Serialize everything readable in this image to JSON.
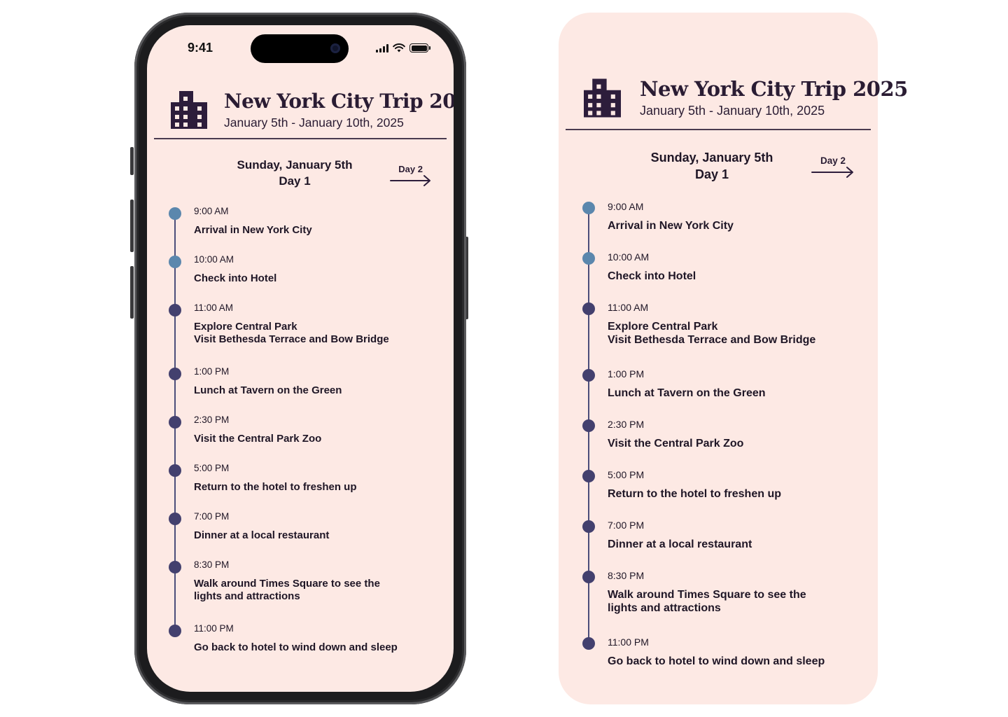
{
  "status_bar": {
    "time": "9:41"
  },
  "trip": {
    "title": "New York City Trip 2025",
    "dates": "January 5th - January 10th, 2025",
    "icon": "building-icon"
  },
  "day": {
    "date": "Sunday, January 5th",
    "label": "Day 1",
    "next_label": "Day 2",
    "next_icon": "arrow-right-icon"
  },
  "colors": {
    "background": "#fde9e4",
    "text": "#2a1c33",
    "dot_completed": "#5b87ad",
    "dot_upcoming": "#43406e",
    "line": "#4c4d7a"
  },
  "events": [
    {
      "time": "9:00 AM",
      "lines": [
        "Arrival in New York City"
      ],
      "status": "completed"
    },
    {
      "time": "10:00 AM",
      "lines": [
        "Check into Hotel"
      ],
      "status": "completed"
    },
    {
      "time": "11:00 AM",
      "lines": [
        "Explore Central Park",
        "Visit Bethesda Terrace and Bow Bridge"
      ],
      "status": "upcoming"
    },
    {
      "time": "1:00 PM",
      "lines": [
        "Lunch at Tavern on the Green"
      ],
      "status": "upcoming"
    },
    {
      "time": "2:30 PM",
      "lines": [
        "Visit the Central Park Zoo"
      ],
      "status": "upcoming"
    },
    {
      "time": "5:00 PM",
      "lines": [
        "Return to the hotel to freshen up"
      ],
      "status": "upcoming"
    },
    {
      "time": "7:00 PM",
      "lines": [
        "Dinner at a local restaurant"
      ],
      "status": "upcoming"
    },
    {
      "time": "8:30 PM",
      "lines": [
        "Walk around Times Square to see the",
        "lights and attractions"
      ],
      "status": "upcoming"
    },
    {
      "time": "11:00 PM",
      "lines": [
        "Go back to hotel to wind down and sleep"
      ],
      "status": "upcoming"
    }
  ]
}
